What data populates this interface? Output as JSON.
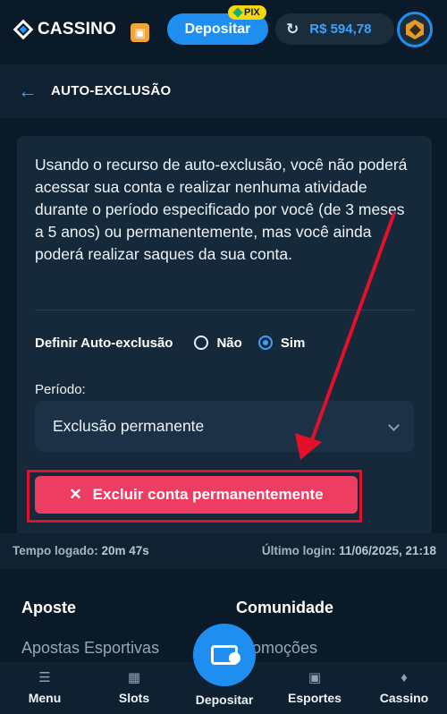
{
  "header": {
    "logo_text": "CASSINO",
    "deposit_label": "Depositar",
    "pix_label": "PIX",
    "balance": "R$ 594,78"
  },
  "page": {
    "title": "AUTO-EXCLUSÃO"
  },
  "card": {
    "description": "Usando o recurso de auto-exclusão, você não poderá acessar sua conta e realizar nenhuma atividade durante o período especificado por você (de 3 meses a 5 anos) ou permanentemente, mas você ainda poderá realizar saques da sua conta.",
    "exclusion_label": "Definir Auto-exclusão",
    "option_no": "Não",
    "option_yes": "Sim",
    "selected_option": "Sim",
    "period_label": "Período:",
    "period_value": "Exclusão permanente",
    "delete_button": "Excluir conta permanentemente"
  },
  "session": {
    "time_label": "Tempo logado:",
    "time_value": "20m 47s",
    "last_login_label": "Último login:",
    "last_login_value": "11/06/2025, 21:18"
  },
  "footer": {
    "col1_title": "Aposte",
    "col1_link": "Apostas Esportivas",
    "col2_title": "Comunidade",
    "col2_link": "Promoções"
  },
  "bottom_nav": {
    "menu": "Menu",
    "slots": "Slots",
    "deposit": "Depositar",
    "sports": "Esportes",
    "casino": "Cassino"
  },
  "colors": {
    "accent": "#1e8ff0",
    "danger": "#ee3d63",
    "annotation": "#e2102a"
  }
}
